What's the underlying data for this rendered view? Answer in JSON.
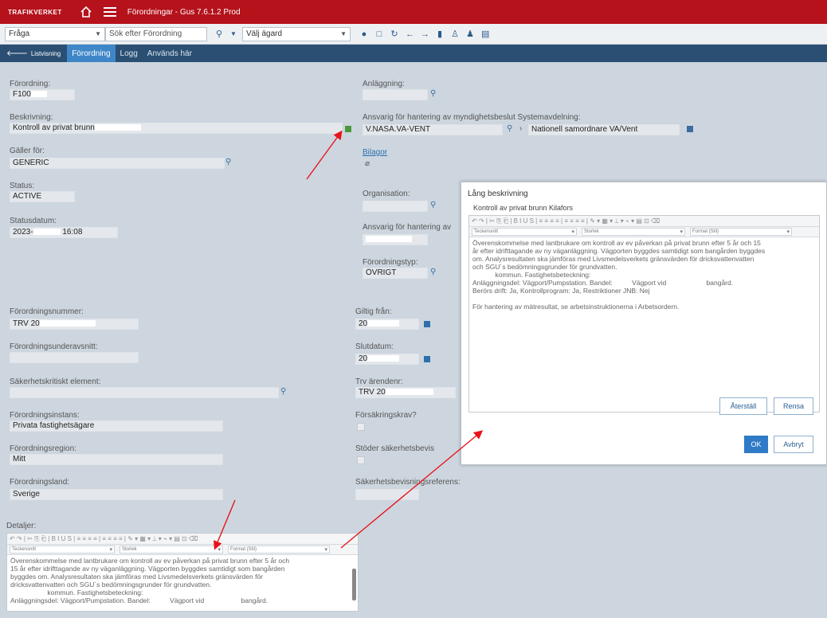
{
  "app": {
    "brand": "TRAFIKVERKET",
    "title": "Förordningar - Gus 7.6.1.2 Prod"
  },
  "toolbar": {
    "query_select": "Fråga",
    "search_placeholder": "Sök efter Förordning",
    "site_select": "Välj ägard"
  },
  "tabs": {
    "back_label": "Listvisning",
    "items": [
      "Förordning",
      "Logg",
      "Används här"
    ]
  },
  "form": {
    "forordning_label": "Förordning:",
    "forordning_value": "F100",
    "beskrivning_label": "Beskrivning:",
    "beskrivning_value": "Kontroll av privat brunn",
    "galler_for_label": "Gäller för:",
    "galler_for_value": "GENERIC",
    "status_label": "Status:",
    "status_value": "ACTIVE",
    "statusdatum_label": "Statusdatum:",
    "statusdatum_prefix": "2023-",
    "statusdatum_suffix": "16:08",
    "nummer_label": "Förordningsnummer:",
    "nummer_value": "TRV 20",
    "underavsnitt_label": "Förordningsunderavsnitt:",
    "sakerhet_label": "Säkerhetskritiskt element:",
    "instans_label": "Förordningsinstans:",
    "instans_value": "Privata fastighetsägare",
    "region_label": "Förordningsregion:",
    "region_value": "Mitt",
    "land_label": "Förordningsland:",
    "land_value": "Sverige",
    "anlaggning_label": "Anläggning:",
    "ansvar_label": "Ansvarig för hantering av myndighetsbeslut Systemavdelning:",
    "ansvar_value": "V.NASA.VA-VENT",
    "ansvar_desc": "Nationell samordnare VA/Vent",
    "bilagor_label": "Bilagor",
    "organisation_label": "Organisation:",
    "ansvar2_label": "Ansvarig för hantering av",
    "typ_label": "Förordningstyp:",
    "typ_value": "ÖVRIGT",
    "giltig_label": "Giltig från:",
    "giltig_value": "20",
    "slut_label": "Slutdatum:",
    "slut_value": "20",
    "arende_label": "Trv ärendenr:",
    "arende_value": "TRV 20",
    "forsakring_label": "Försäkringskrav?",
    "stoder_label": "Stöder säkerhetsbevis",
    "sakref_label": "Säkerhetsbevisningsreferens:",
    "detaljer_label": "Detaljer:"
  },
  "editor": {
    "toolbar_glyphs": "↶ ↷ | ✂ ⎘ ⎗ | B I U S | ≡ ≡ ≡ ≡ | ≡ ≡ ≡ ≡ | ✎ ▾ ▦ ▾ ⟂ ▾ ⌁ ▾ ▤ ⊡ ⌫",
    "select_1": "Teckensnitt",
    "select_2": "Storlek",
    "select_3": "Format (Stil)"
  },
  "details_text": {
    "line1": "Överenskommelse med lantbrukare om kontroll av ev påverkan på privat brunn efter 5 år och",
    "line2": "15 år efter idrifttagande av ny väganläggning. Vägporten byggdes samtidigt som bangården",
    "line3": "byggdes om.  Analysresultaten ska jämföras med Livsmedelsverkets gränsvärden för",
    "line4": "dricksvattenvatten och SGU´s bedömningsgrunder för grundvatten.",
    "line5": "kommun. Fastighetsbeteckning:",
    "line6": "Anläggningsdel: Vägport/Pumpstation. Bandel:",
    "line6b": "Vägport vid",
    "line6c": "bangård."
  },
  "dialog": {
    "title": "Lång beskrivning",
    "subtitle": "Kontroll av privat brunn Kilafors",
    "line1": "Överenskommelse med lantbrukare om kontroll av ev påverkan på privat brunn efter 5 år och 15",
    "line2": "år efter idrifttagande av ny väganläggning. Vägporten byggdes samtidigt som bangården byggdes",
    "line3": "om.  Analysresultaten ska jämföras med Livsmedelsverkets gränsvärden för dricksvattenvatten",
    "line4": "och SGU´s bedömningsgrunder för grundvatten.",
    "line5": "kommun. Fastighetsbeteckning:",
    "line6": "Anläggningsdel: Vägport/Pumpstation. Bandel:",
    "line6b": "Vägport vid",
    "line6c": "bangård.",
    "line7": "Berörs drift: Ja, Kontrollprogram: Ja, Restriktioner JNB: Nej",
    "line8": "För hantering av mätresultat, se arbetsinstruktionerna i Arbetsordern.",
    "btn_restore": "Återställ",
    "btn_clear": "Rensa",
    "btn_ok": "OK",
    "btn_cancel": "Avbryt"
  },
  "colors": {
    "topbar": "#b5121b",
    "tabbar": "#2a4f73",
    "tab_active": "#3e86c7",
    "arrow": "#e8141c"
  }
}
